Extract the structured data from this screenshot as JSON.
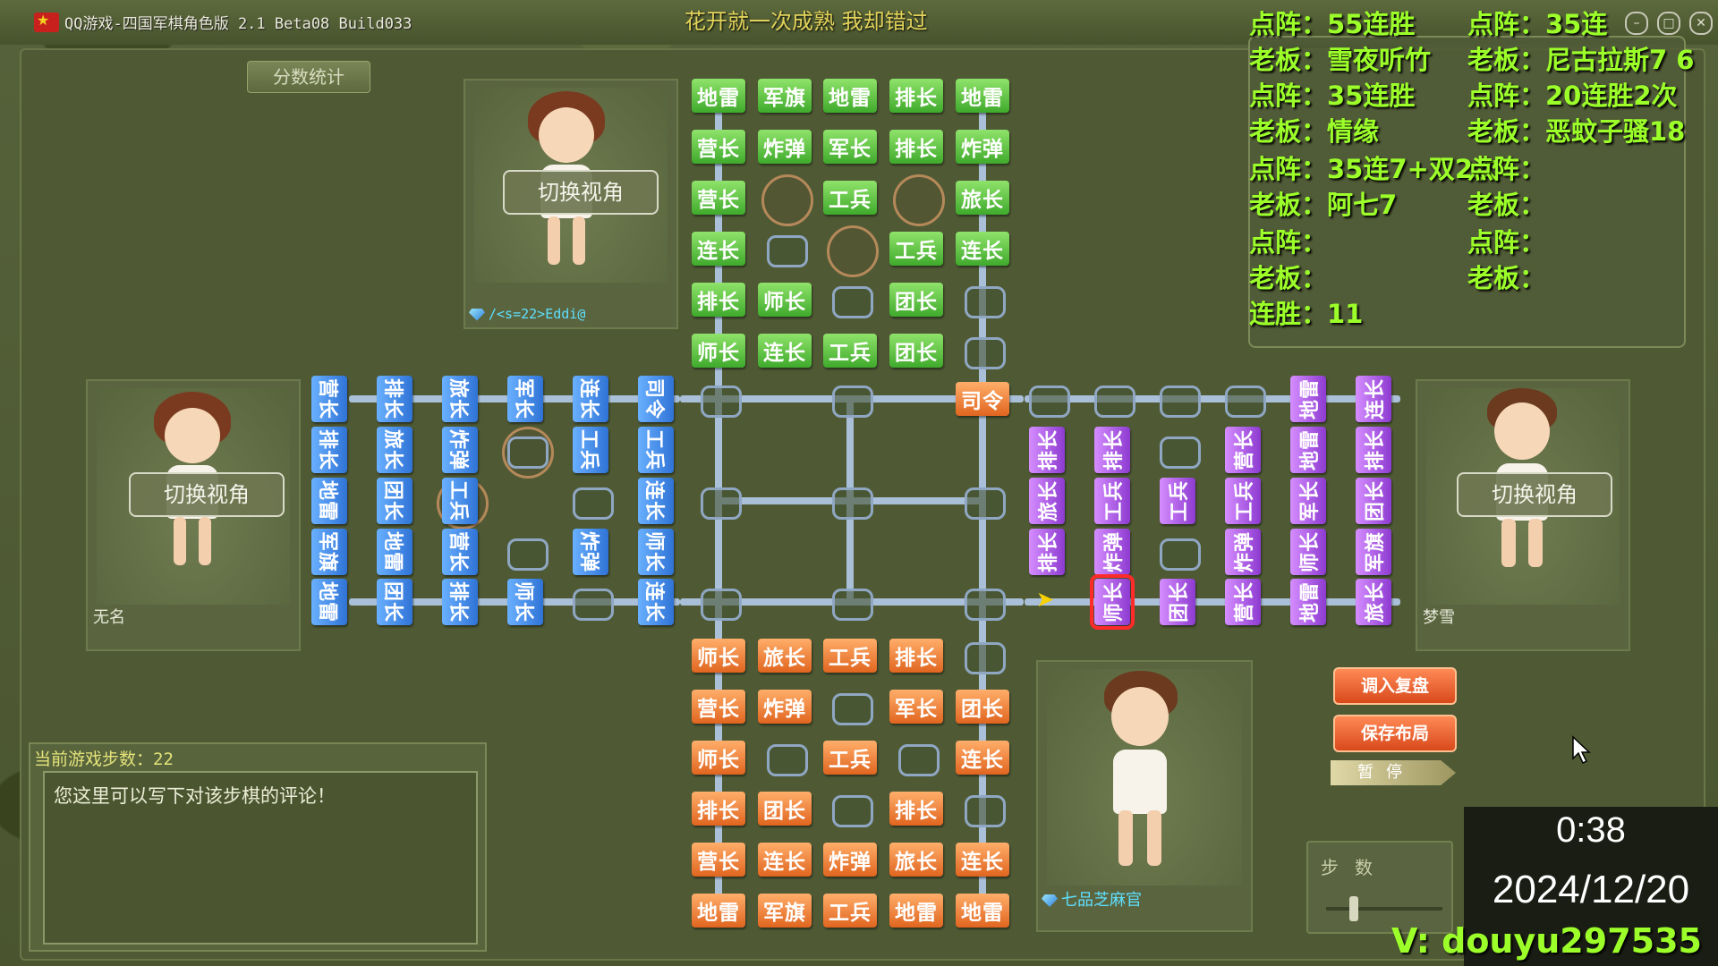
{
  "window": {
    "title": "QQ游戏-四国军棋角色版 2.1 Beta08 Build033",
    "marquee": "花开就一次成熟 我却错过"
  },
  "tabs": {
    "score_stats": "分数统计"
  },
  "players": {
    "top": {
      "name": "/<s=22>Eddi@",
      "switch_view": "切换视角"
    },
    "left": {
      "name": "无名",
      "switch_view": "切换视角"
    },
    "right": {
      "name": "梦雪",
      "switch_view": "切换视角"
    },
    "bottom": {
      "name": "七品芝麻官"
    }
  },
  "board": {
    "top_pieces": [
      "地雷",
      "军旗",
      "地雷",
      "排长",
      "地雷",
      "营长",
      "炸弹",
      "军长",
      "排长",
      "炸弹",
      "营长",
      "工兵",
      "旅长",
      "连长",
      "工兵",
      "连长",
      "排长",
      "师长",
      "团长",
      "师长",
      "连长",
      "工兵",
      "团长",
      "司令"
    ],
    "bottom_pieces": [
      "师长",
      "旅长",
      "工兵",
      "排长",
      "营长",
      "炸弹",
      "军长",
      "团长",
      "师长",
      "工兵",
      "连长",
      "排长",
      "团长",
      "排长",
      "营长",
      "连长",
      "炸弹",
      "旅长",
      "连长",
      "地雷",
      "军旗",
      "工兵",
      "地雷",
      "地雷"
    ],
    "left_pieces": [
      "营长",
      "排长",
      "旅长",
      "军长",
      "连长",
      "司令",
      "排长",
      "旅长",
      "炸弹",
      "工兵",
      "工兵",
      "地雷",
      "团长",
      "工兵",
      "连长",
      "军旗",
      "地雷",
      "营长",
      "炸弹",
      "师长",
      "地雷",
      "团长",
      "排长",
      "师长",
      "连长"
    ],
    "right_pieces": [
      "地雷",
      "连长",
      "排长",
      "排长",
      "营长",
      "地雷",
      "排长",
      "旅长",
      "工兵",
      "工兵",
      "工兵",
      "军长",
      "团长",
      "排长",
      "炸弹",
      "炸弹",
      "师长",
      "军旗",
      "师长",
      "团长",
      "营长",
      "地雷",
      "旅长"
    ]
  },
  "info_panel": {
    "lines": [
      [
        "点阵：55连胜",
        "点阵：35连"
      ],
      [
        "老板：雪夜听竹",
        "老板：尼古拉斯7 6"
      ],
      [
        "点阵：35连胜",
        "点阵：20连胜2次"
      ],
      [
        "老板：情缘",
        "老板：恶蚊子骚18"
      ],
      [
        "点阵：35连7+双2次",
        "点阵："
      ],
      [
        "老板：阿七7",
        "老板："
      ],
      [
        "点阵：",
        "点阵："
      ],
      [
        "老板：",
        "老板："
      ],
      [
        "连胜：11",
        ""
      ]
    ]
  },
  "controls": {
    "load_replay": "调入复盘",
    "save_layout": "保存布局",
    "pause": "暂停",
    "steps_label": "步数"
  },
  "comment": {
    "title": "当前游戏步数：22",
    "placeholder": "您这里可以写下对该步棋的评论！"
  },
  "overlay": {
    "time": "0:38",
    "date": "2024/12/20",
    "contact": "V:  douyu297535"
  },
  "colors": {
    "green_piece": "#4fbb35",
    "orange_piece": "#e8742a",
    "blue_piece": "#3b82e0",
    "purple_piece": "#9a48d6",
    "overlay_text": "#9cff2a"
  }
}
